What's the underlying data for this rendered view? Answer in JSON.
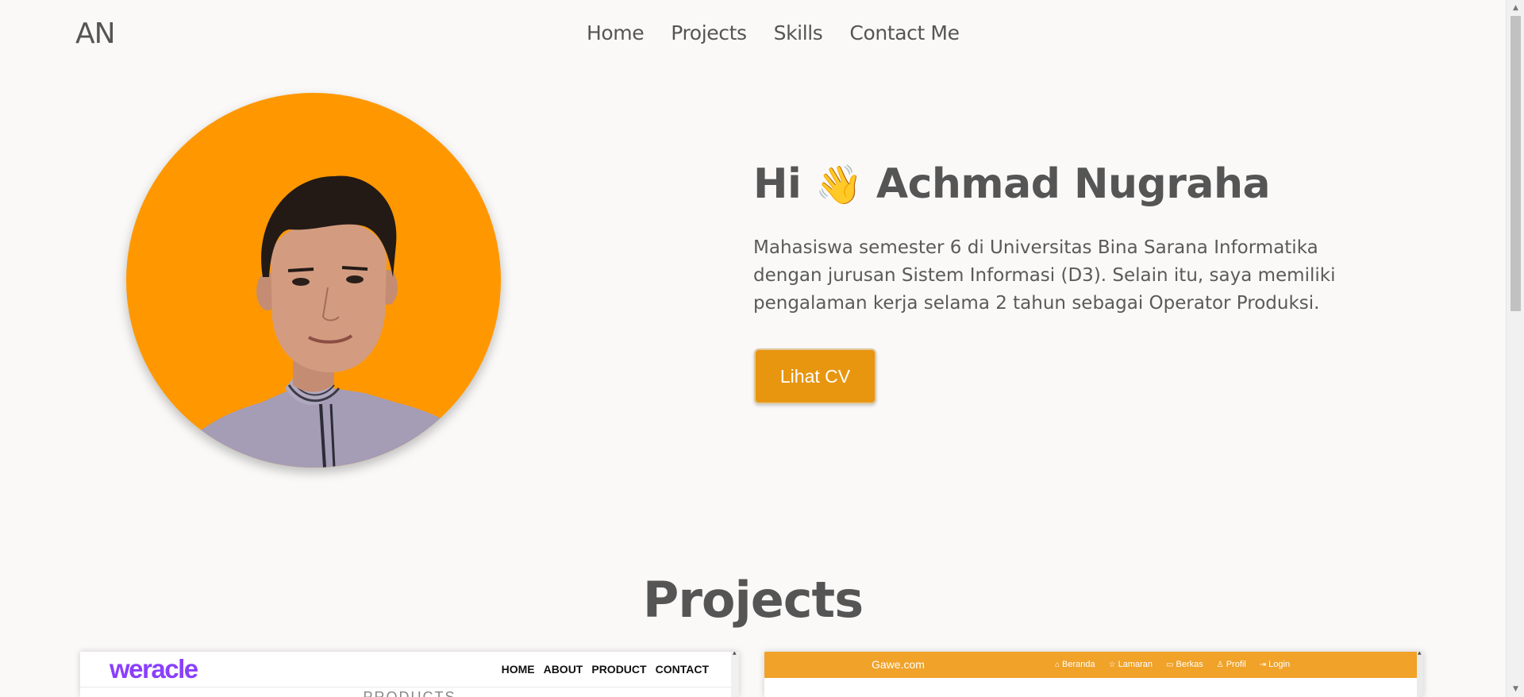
{
  "navbar": {
    "logo": "AN",
    "links": [
      "Home",
      "Projects",
      "Skills",
      "Contact Me"
    ]
  },
  "hero": {
    "greeting": "Hi",
    "wave": "👋",
    "name": "Achmad Nugraha",
    "description": "Mahasiswa semester 6 di Universitas Bina Sarana Informatika dengan jurusan Sistem Informasi (D3). Selain itu, saya memiliki pengalaman kerja selama 2 tahun sebagai Operator Produksi.",
    "cv_button": "Lihat CV",
    "avatar_bg": "#ff9800"
  },
  "projects": {
    "heading": "Projects",
    "card1": {
      "logo": "weracle",
      "links": [
        "HOME",
        "ABOUT",
        "PRODUCT",
        "CONTACT"
      ],
      "subheading": "PRODUCTS"
    },
    "card2": {
      "brand": "Gawe.com",
      "links": [
        {
          "icon": "home-icon",
          "label": "Beranda"
        },
        {
          "icon": "star-icon",
          "label": "Lamaran"
        },
        {
          "icon": "folder-icon",
          "label": "Berkas"
        },
        {
          "icon": "user-icon",
          "label": "Profil"
        },
        {
          "icon": "login-icon",
          "label": "Login"
        }
      ]
    }
  },
  "colors": {
    "accent": "#e8960f",
    "background": "#faf9f8",
    "text": "#555555",
    "weracle_purple": "#8a3ffc",
    "gawe_orange": "#f0a229"
  }
}
